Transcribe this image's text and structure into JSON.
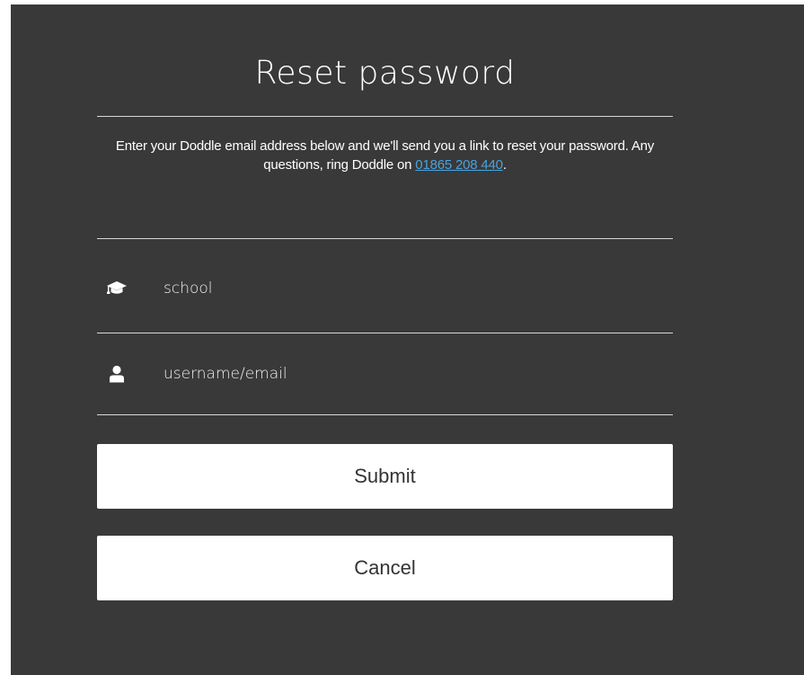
{
  "reset_form": {
    "title": "Reset password",
    "intro_text": "Enter your Doddle email address below and we'll send you a link to reset your password. Any questions, ring Doddle on ",
    "phone_link": "01865 208 440",
    "intro_suffix": ".",
    "school_field": {
      "placeholder": "school",
      "value": "",
      "icon": "graduation-cap-icon"
    },
    "username_field": {
      "placeholder": "username/email",
      "value": "",
      "icon": "user-icon"
    },
    "submit_label": "Submit",
    "cancel_label": "Cancel"
  },
  "colors": {
    "panel_background": "#393939",
    "text": "#ffffff",
    "link": "#4aa3df",
    "divider": "#d8d8d8",
    "button_background": "#ffffff",
    "button_text": "#333333"
  }
}
